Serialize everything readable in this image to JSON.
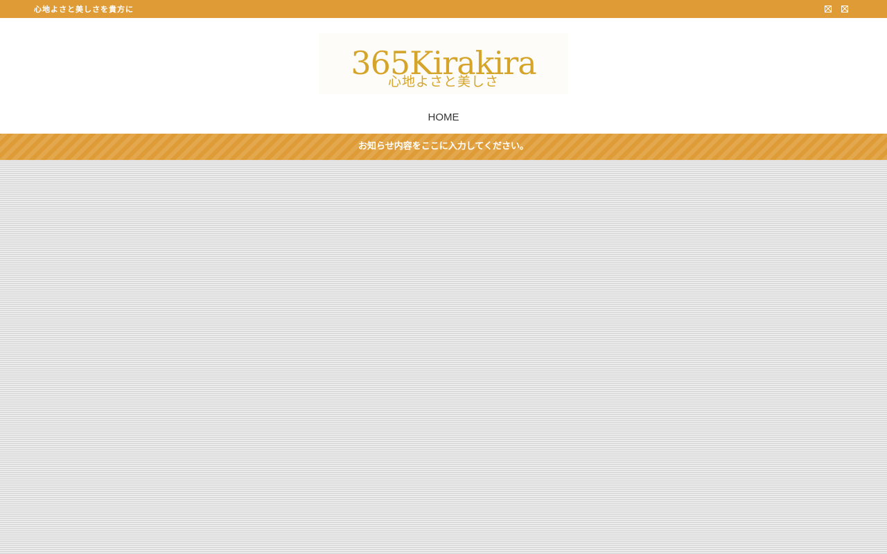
{
  "topbar": {
    "tagline": "心地よさと美しさを貴方に",
    "icons": [
      "missing-image-icon",
      "missing-image-icon"
    ]
  },
  "header": {
    "logo_text": "365Kirakira",
    "logo_subtext": "心地よさと美しさ"
  },
  "nav": {
    "items": [
      {
        "label": "HOME"
      }
    ]
  },
  "notice": {
    "text": "お知らせ内容をここに入力してください。"
  },
  "colors": {
    "accent": "#df9b36",
    "logo": "#d5a52b"
  }
}
